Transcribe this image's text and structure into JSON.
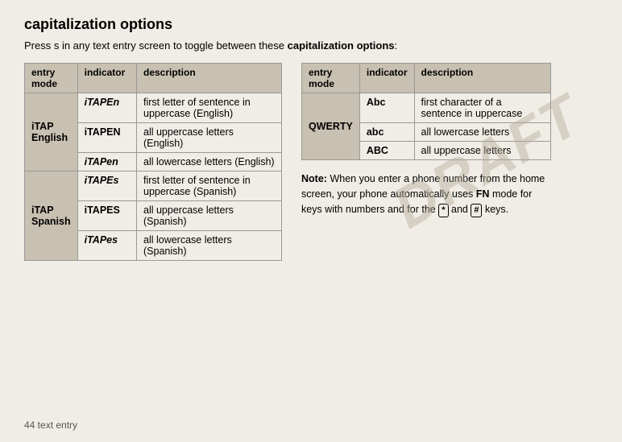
{
  "page": {
    "title": "capitalization options",
    "intro": "Press s in any text entry screen to toggle between these",
    "intro_bold": "capitalization options",
    "intro_colon": ":",
    "footer": "44    text entry"
  },
  "left_table": {
    "headers": [
      "entry mode",
      "indicator",
      "description"
    ],
    "groups": [
      {
        "group_label": "iTAP English",
        "rows": [
          {
            "indicator": "iTAPEn",
            "indicator_style": "italic",
            "description": "first letter of sentence in uppercase (English)"
          },
          {
            "indicator": "iTAPEN",
            "indicator_style": "normal",
            "description": "all uppercase letters (English)"
          },
          {
            "indicator": "iTAPen",
            "indicator_style": "italic-small",
            "description": "all lowercase letters (English)"
          }
        ]
      },
      {
        "group_label": "iTAP Spanish",
        "rows": [
          {
            "indicator": "iTAPEs",
            "indicator_style": "italic-s",
            "description": "first letter of sentence in uppercase (Spanish)"
          },
          {
            "indicator": "iTAPES",
            "indicator_style": "normal",
            "description": "all uppercase letters (Spanish)"
          },
          {
            "indicator": "iTAPes",
            "indicator_style": "italic-small",
            "description": "all lowercase letters (Spanish)"
          }
        ]
      }
    ]
  },
  "right_table": {
    "headers": [
      "entry mode",
      "indicator",
      "description"
    ],
    "groups": [
      {
        "group_label": "QWERTY",
        "rows": [
          {
            "indicator": "Abc",
            "indicator_style": "title",
            "description": "first character of a sentence in uppercase"
          },
          {
            "indicator": "abc",
            "indicator_style": "lower",
            "description": "all lowercase letters"
          },
          {
            "indicator": "ABC",
            "indicator_style": "upper",
            "description": "all uppercase letters"
          }
        ]
      }
    ]
  },
  "note": {
    "label": "Note:",
    "text": " When you enter a phone number from the home screen, your phone automatically uses ",
    "fn_mode": "FN",
    "text2": " mode for keys with numbers and for the ",
    "key1": "*",
    "text3": " and ",
    "key2": "#",
    "text4": " keys."
  },
  "draft_text": "DRAFT",
  "footer_text": "44    text entry"
}
